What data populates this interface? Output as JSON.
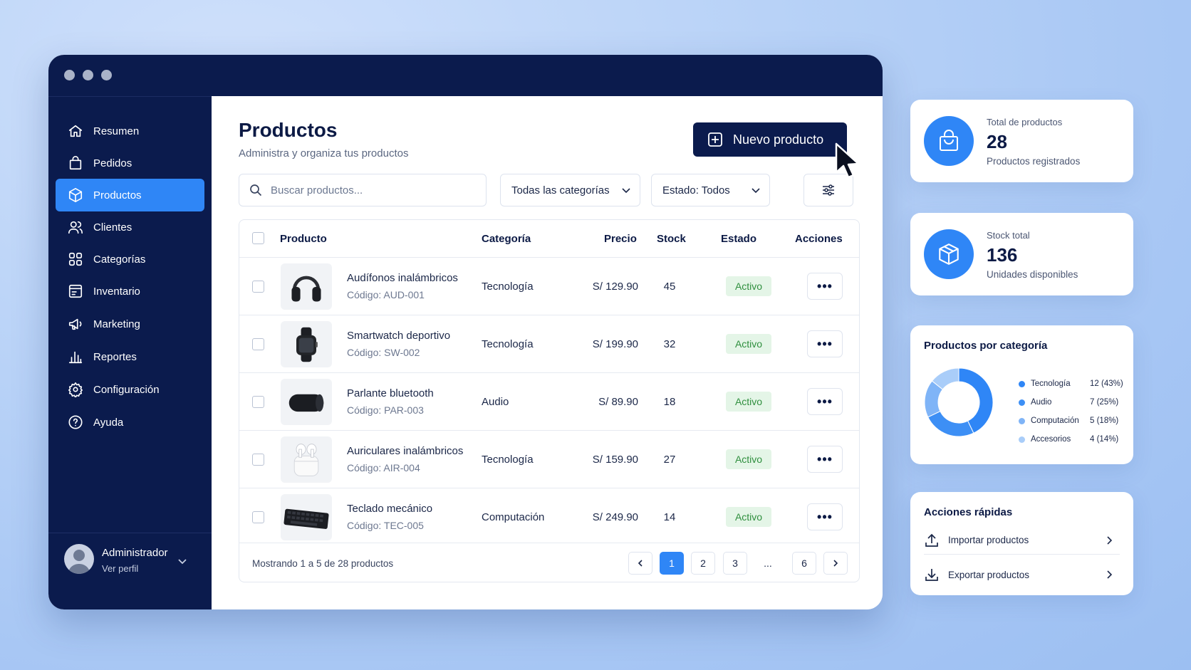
{
  "sidebar": {
    "items": [
      {
        "label": "Resumen",
        "icon": "home-icon"
      },
      {
        "label": "Pedidos",
        "icon": "shopping-bag-icon"
      },
      {
        "label": "Productos",
        "icon": "box-icon",
        "active": true
      },
      {
        "label": "Clientes",
        "icon": "users-icon"
      },
      {
        "label": "Categorías",
        "icon": "grid-icon"
      },
      {
        "label": "Inventario",
        "icon": "inventory-icon"
      },
      {
        "label": "Marketing",
        "icon": "megaphone-icon"
      },
      {
        "label": "Reportes",
        "icon": "bar-chart-icon"
      },
      {
        "label": "Configuración",
        "icon": "gear-icon"
      },
      {
        "label": "Ayuda",
        "icon": "help-icon"
      }
    ],
    "profile": {
      "name": "Administrador",
      "link": "Ver perfil"
    }
  },
  "main": {
    "title": "Productos",
    "subtitle": "Administra y organiza tus productos",
    "new_button": "Nuevo producto",
    "search_placeholder": "Buscar productos...",
    "category_filter": "Todas las categorías",
    "status_filter": "Estado: Todos",
    "table": {
      "headers": {
        "product": "Producto",
        "category": "Categoría",
        "price": "Precio",
        "stock": "Stock",
        "status": "Estado",
        "actions": "Acciones"
      },
      "rows": [
        {
          "name": "Audífonos inalámbricos",
          "code": "Código: AUD-001",
          "category": "Tecnología",
          "price": "S/ 129.90",
          "stock": "45",
          "status": "Activo",
          "image": "headphones"
        },
        {
          "name": "Smartwatch deportivo",
          "code": "Código: SW-002",
          "category": "Tecnología",
          "price": "S/ 199.90",
          "stock": "32",
          "status": "Activo",
          "image": "smartwatch"
        },
        {
          "name": "Parlante bluetooth",
          "code": "Código: PAR-003",
          "category": "Audio",
          "price": "S/ 89.90",
          "stock": "18",
          "status": "Activo",
          "image": "speaker"
        },
        {
          "name": "Auriculares inalámbricos",
          "code": "Código: AIR-004",
          "category": "Tecnología",
          "price": "S/ 159.90",
          "stock": "27",
          "status": "Activo",
          "image": "earbuds"
        },
        {
          "name": "Teclado mecánico",
          "code": "Código: TEC-005",
          "category": "Computación",
          "price": "S/ 249.90",
          "stock": "14",
          "status": "Activo",
          "image": "keyboard"
        }
      ]
    },
    "pagination": {
      "summary": "Mostrando 1 a 5 de 28 productos",
      "pages": [
        "1",
        "2",
        "3",
        "...",
        "6"
      ],
      "current": "1"
    }
  },
  "stats": {
    "total": {
      "label": "Total de productos",
      "value": "28",
      "sub": "Productos registrados"
    },
    "stock": {
      "label": "Stock total",
      "value": "136",
      "sub": "Unidades disponibles"
    }
  },
  "category_chart": {
    "title": "Productos por categoría",
    "items": [
      {
        "label": "Tecnología",
        "value": "12 (43%)",
        "color": "#2f86f6"
      },
      {
        "label": "Audio",
        "value": "7 (25%)",
        "color": "#3d8ff5"
      },
      {
        "label": "Computación",
        "value": "5 (18%)",
        "color": "#7fb4f7"
      },
      {
        "label": "Accesorios",
        "value": "4 (14%)",
        "color": "#a9cdf9"
      }
    ]
  },
  "quick_actions": {
    "title": "Acciones rápidas",
    "items": [
      {
        "label": "Importar productos",
        "icon": "upload-icon"
      },
      {
        "label": "Exportar productos",
        "icon": "download-icon"
      }
    ]
  },
  "colors": {
    "navy": "#0b1b4d",
    "accent": "#2f86f6",
    "success_bg": "#e4f5e7",
    "success_text": "#2f8f3e"
  }
}
